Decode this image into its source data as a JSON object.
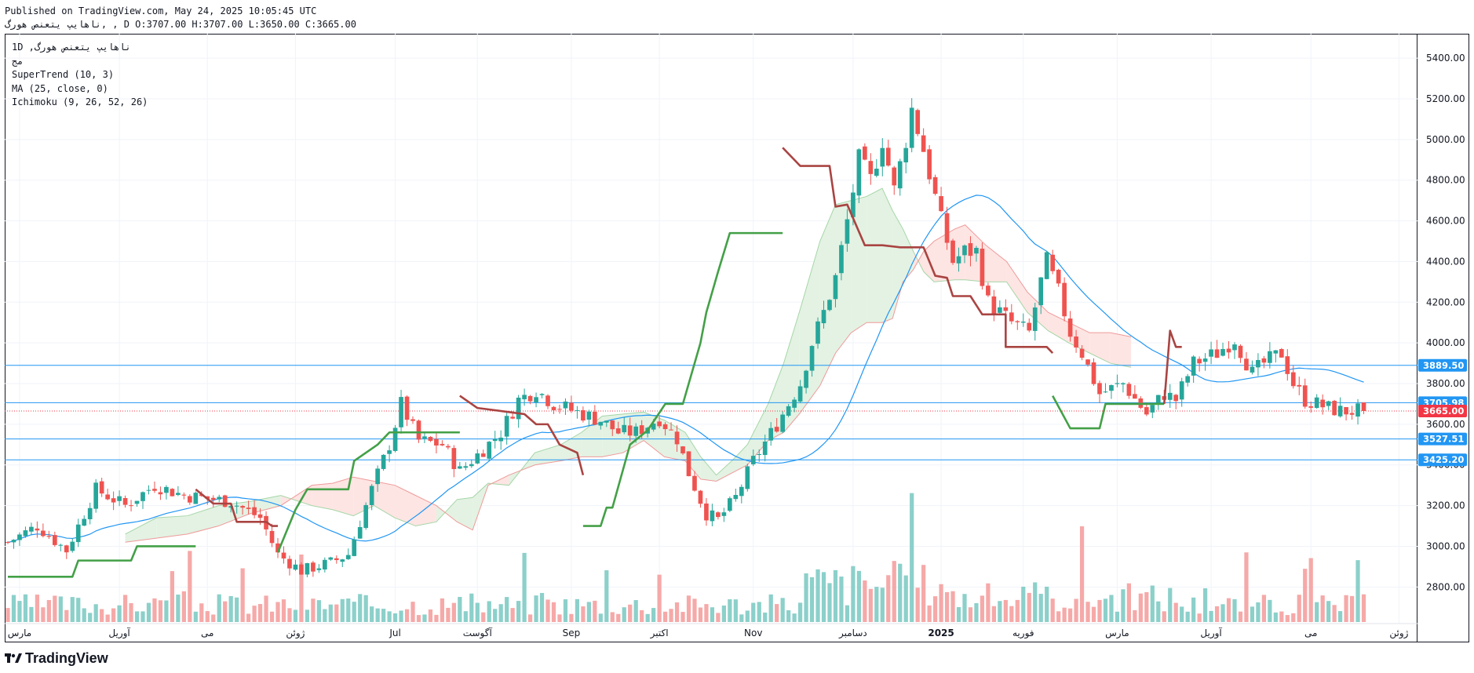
{
  "header": {
    "line1": "Published on TradingView.com, May 24, 2025 10:05:45 UTC",
    "line2": "ناهایپ یتعنص هورگ, , D O:3707.00 H:3707.00 L:3650.00 C:3665.00"
  },
  "legend": {
    "symbol": "1D ,ناهایپ یتعنص هورگ",
    "exchange": "مج",
    "indicators": [
      "SuperTrend (10, 3)",
      "MA (25, close, 0)",
      "Ichimoku (9, 26, 52, 26)"
    ]
  },
  "footer": {
    "brand": "TradingView"
  },
  "colors": {
    "up": "#26a69a",
    "down": "#ef5350",
    "supertrend_up": "#43a047",
    "supertrend_down": "#a94442",
    "ma": "#2196f3",
    "hline": "#2196f3",
    "cloud_bull": "#e3f2e3",
    "cloud_bear": "#fde5e3",
    "last": "#f23645"
  },
  "chart_data": {
    "type": "candlestick",
    "timeframe": "1D",
    "ylim": [
      2620,
      5520
    ],
    "yticks": [
      2800,
      3000,
      3200,
      3400,
      3600,
      3800,
      4000,
      4200,
      4400,
      4600,
      4800,
      5000,
      5200,
      5400
    ],
    "ytick_labels": [
      "2800.00",
      "3000.00",
      "3200.00",
      "3400.00",
      "3600.00",
      "3800.00",
      "4000.00",
      "4200.00",
      "4400.00",
      "4600.00",
      "4800.00",
      "5000.00",
      "5200.00",
      "5400.00"
    ],
    "xaxis_labels": [
      "مارس",
      "آوریل",
      "می",
      "ژوئن",
      "Jul",
      "آگوست",
      "Sep",
      "اکتبر",
      "Nov",
      "دسامبر",
      "2025",
      "فوریه",
      "مارس",
      "آوریل",
      "می",
      "ژوئن"
    ],
    "n_bars": 232,
    "xaxis_label_bars": [
      2,
      19,
      34,
      49,
      66,
      80,
      96,
      111,
      127,
      144,
      159,
      173,
      189,
      205,
      222,
      237
    ],
    "last_bar": {
      "open": 3707,
      "high": 3707,
      "low": 3650,
      "close": 3665
    },
    "horizontal_lines": [
      {
        "price": 3889.5,
        "label": "3889.50"
      },
      {
        "price": 3705.98,
        "label": "3705.98"
      },
      {
        "price": 3527.51,
        "label": "3527.51"
      },
      {
        "price": 3425.2,
        "label": "3425.20"
      }
    ],
    "last_price": {
      "price": 3665,
      "label": "3665.00"
    },
    "close_anchors": [
      [
        0,
        3020
      ],
      [
        5,
        3100
      ],
      [
        10,
        2980
      ],
      [
        15,
        3280
      ],
      [
        20,
        3200
      ],
      [
        25,
        3300
      ],
      [
        30,
        3250
      ],
      [
        38,
        3220
      ],
      [
        43,
        3140
      ],
      [
        46,
        2960
      ],
      [
        50,
        2880
      ],
      [
        55,
        2920
      ],
      [
        58,
        2960
      ],
      [
        62,
        3280
      ],
      [
        65,
        3500
      ],
      [
        67,
        3700
      ],
      [
        70,
        3520
      ],
      [
        74,
        3500
      ],
      [
        77,
        3370
      ],
      [
        80,
        3450
      ],
      [
        84,
        3560
      ],
      [
        87,
        3720
      ],
      [
        90,
        3770
      ],
      [
        93,
        3700
      ],
      [
        97,
        3660
      ],
      [
        101,
        3620
      ],
      [
        104,
        3560
      ],
      [
        107,
        3560
      ],
      [
        111,
        3630
      ],
      [
        114,
        3530
      ],
      [
        116,
        3360
      ],
      [
        119,
        3160
      ],
      [
        121,
        3130
      ],
      [
        124,
        3240
      ],
      [
        127,
        3420
      ],
      [
        131,
        3600
      ],
      [
        135,
        3800
      ],
      [
        137,
        4000
      ],
      [
        139,
        4150
      ],
      [
        141,
        4320
      ],
      [
        143,
        4600
      ],
      [
        145,
        4900
      ],
      [
        147,
        4800
      ],
      [
        149,
        5000
      ],
      [
        151,
        4750
      ],
      [
        153,
        5000
      ],
      [
        154,
        5150
      ],
      [
        156,
        4950
      ],
      [
        159,
        4600
      ],
      [
        161,
        4400
      ],
      [
        163,
        4450
      ],
      [
        165,
        4450
      ],
      [
        167,
        4200
      ],
      [
        171,
        4100
      ],
      [
        174,
        4050
      ],
      [
        176,
        4300
      ],
      [
        177,
        4400
      ],
      [
        179,
        4250
      ],
      [
        181,
        4050
      ],
      [
        183,
        3950
      ],
      [
        186,
        3750
      ],
      [
        190,
        3800
      ],
      [
        194,
        3650
      ],
      [
        197,
        3750
      ],
      [
        199,
        3720
      ],
      [
        202,
        3900
      ],
      [
        206,
        3950
      ],
      [
        209,
        4020
      ],
      [
        212,
        3850
      ],
      [
        214,
        3900
      ],
      [
        217,
        3950
      ],
      [
        219,
        3800
      ],
      [
        221,
        3720
      ],
      [
        223,
        3700
      ],
      [
        225,
        3680
      ],
      [
        227,
        3665
      ]
    ],
    "supertrend_segments": [
      {
        "trend": "up",
        "points": [
          [
            0,
            2850
          ],
          [
            11,
            2850
          ],
          [
            12,
            2930
          ],
          [
            21,
            2930
          ],
          [
            22,
            3000
          ],
          [
            32,
            3000
          ]
        ]
      },
      {
        "trend": "down",
        "points": [
          [
            32,
            3280
          ],
          [
            35,
            3210
          ],
          [
            38,
            3210
          ],
          [
            39,
            3120
          ],
          [
            44,
            3120
          ],
          [
            45,
            3100
          ],
          [
            46,
            3100
          ]
        ]
      },
      {
        "trend": "up",
        "points": [
          [
            46,
            2970
          ],
          [
            49,
            3180
          ],
          [
            51,
            3280
          ],
          [
            58,
            3280
          ],
          [
            59,
            3420
          ],
          [
            63,
            3500
          ],
          [
            65,
            3560
          ],
          [
            77,
            3560
          ]
        ]
      },
      {
        "trend": "down",
        "points": [
          [
            77,
            3740
          ],
          [
            80,
            3680
          ],
          [
            88,
            3650
          ],
          [
            90,
            3600
          ],
          [
            92,
            3600
          ],
          [
            94,
            3500
          ],
          [
            97,
            3460
          ],
          [
            98,
            3350
          ]
        ]
      },
      {
        "trend": "up",
        "points": [
          [
            98,
            3100
          ],
          [
            101,
            3100
          ],
          [
            102,
            3190
          ],
          [
            103,
            3190
          ],
          [
            106,
            3500
          ],
          [
            109,
            3570
          ],
          [
            112,
            3700
          ],
          [
            115,
            3700
          ],
          [
            118,
            4000
          ],
          [
            119,
            4150
          ],
          [
            121,
            4350
          ],
          [
            123,
            4540
          ],
          [
            132,
            4540
          ]
        ]
      },
      {
        "trend": "down",
        "points": [
          [
            132,
            4960
          ],
          [
            135,
            4870
          ],
          [
            137,
            4870
          ],
          [
            140,
            4870
          ],
          [
            141,
            4670
          ],
          [
            143,
            4680
          ],
          [
            146,
            4480
          ],
          [
            149,
            4480
          ],
          [
            152,
            4470
          ],
          [
            156,
            4470
          ],
          [
            158,
            4330
          ],
          [
            160,
            4320
          ],
          [
            161,
            4230
          ],
          [
            164,
            4230
          ],
          [
            166,
            4140
          ],
          [
            170,
            4140
          ],
          [
            170,
            3980
          ],
          [
            177,
            3980
          ],
          [
            178,
            3950
          ]
        ]
      },
      {
        "trend": "up",
        "points": [
          [
            178,
            3740
          ],
          [
            181,
            3580
          ],
          [
            186,
            3580
          ],
          [
            187,
            3700
          ],
          [
            197,
            3700
          ]
        ]
      },
      {
        "trend": "down",
        "points": [
          [
            197,
            3700
          ],
          [
            198,
            4060
          ],
          [
            199,
            3980
          ],
          [
            200,
            3980
          ]
        ]
      }
    ],
    "ichimoku_cloud": [
      [
        0,
        3060,
        3020
      ],
      [
        6,
        3140,
        3040
      ],
      [
        12,
        3150,
        3060
      ],
      [
        18,
        3200,
        3100
      ],
      [
        24,
        3220,
        3160
      ],
      [
        30,
        3250,
        3200
      ],
      [
        36,
        3200,
        3300
      ],
      [
        40,
        3180,
        3310
      ],
      [
        44,
        3150,
        3340
      ],
      [
        48,
        3200,
        3320
      ],
      [
        52,
        3140,
        3300
      ],
      [
        56,
        3100,
        3250
      ],
      [
        60,
        3120,
        3200
      ],
      [
        64,
        3230,
        3120
      ],
      [
        67,
        3240,
        3080
      ],
      [
        70,
        3310,
        3300
      ],
      [
        74,
        3300,
        3350
      ],
      [
        79,
        3460,
        3400
      ],
      [
        84,
        3500,
        3420
      ],
      [
        88,
        3560,
        3440
      ],
      [
        92,
        3640,
        3440
      ],
      [
        96,
        3650,
        3460
      ],
      [
        100,
        3660,
        3520
      ],
      [
        104,
        3620,
        3440
      ],
      [
        108,
        3560,
        3420
      ],
      [
        111,
        3440,
        3330
      ],
      [
        114,
        3350,
        3320
      ],
      [
        117,
        3420,
        3360
      ],
      [
        120,
        3500,
        3400
      ],
      [
        124,
        3700,
        3520
      ],
      [
        127,
        3900,
        3560
      ],
      [
        130,
        4150,
        3650
      ],
      [
        134,
        4500,
        3790
      ],
      [
        137,
        4680,
        3950
      ],
      [
        140,
        4700,
        4050
      ],
      [
        143,
        4720,
        4100
      ],
      [
        146,
        4760,
        4100
      ],
      [
        148,
        4650,
        4120
      ],
      [
        150,
        4560,
        4300
      ],
      [
        152,
        4450,
        4360
      ],
      [
        154,
        4350,
        4450
      ],
      [
        156,
        4300,
        4500
      ],
      [
        160,
        4310,
        4560
      ],
      [
        162,
        4310,
        4580
      ],
      [
        166,
        4300,
        4480
      ],
      [
        170,
        4300,
        4400
      ],
      [
        174,
        4150,
        4250
      ],
      [
        178,
        4060,
        4150
      ],
      [
        182,
        4000,
        4100
      ],
      [
        186,
        3950,
        4050
      ],
      [
        190,
        3900,
        4050
      ],
      [
        194,
        3880,
        4030
      ]
    ],
    "ichimoku_cloud_start_bar": 20,
    "volume_scale_max": 1000
  }
}
